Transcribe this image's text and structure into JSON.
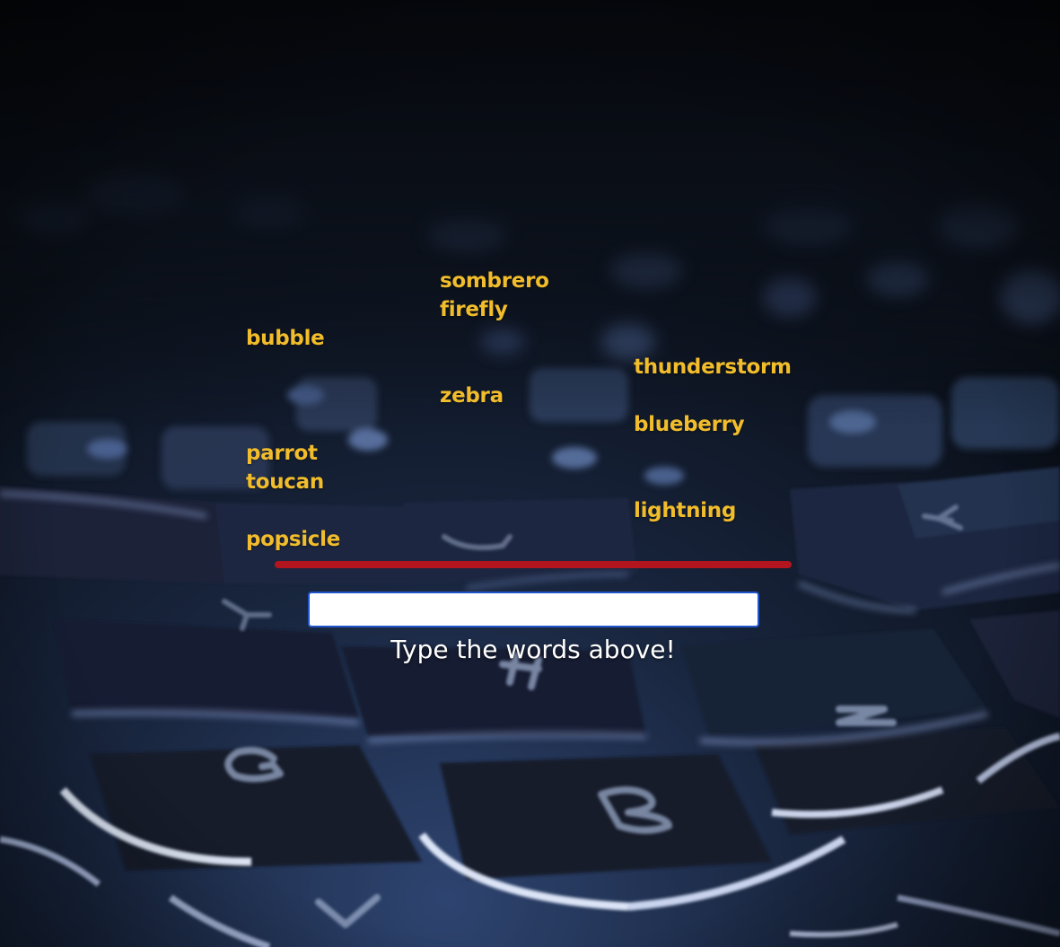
{
  "background": {
    "image": "backlit-keyboard-photo",
    "key_legends": [
      "Y",
      "U",
      "K",
      "G",
      "H",
      "N",
      "B",
      "V"
    ]
  },
  "game": {
    "words": [
      {
        "text": "sombrero",
        "column": 2,
        "row": 0
      },
      {
        "text": "firefly",
        "column": 2,
        "row": 1
      },
      {
        "text": "bubble",
        "column": 1,
        "row": 2
      },
      {
        "text": "thunderstorm",
        "column": 3,
        "row": 3
      },
      {
        "text": "zebra",
        "column": 2,
        "row": 4
      },
      {
        "text": "blueberry",
        "column": 3,
        "row": 5
      },
      {
        "text": "parrot",
        "column": 1,
        "row": 6
      },
      {
        "text": "toucan",
        "column": 1,
        "row": 7
      },
      {
        "text": "lightning",
        "column": 3,
        "row": 8
      },
      {
        "text": "popsicle",
        "column": 1,
        "row": 9
      }
    ],
    "input_value": "",
    "instruction": "Type the words above!"
  },
  "colors": {
    "word": "#f2bd2c",
    "danger_line": "#b3151f",
    "input_border": "#1f56c9",
    "instruction_text": "#ffffff"
  }
}
